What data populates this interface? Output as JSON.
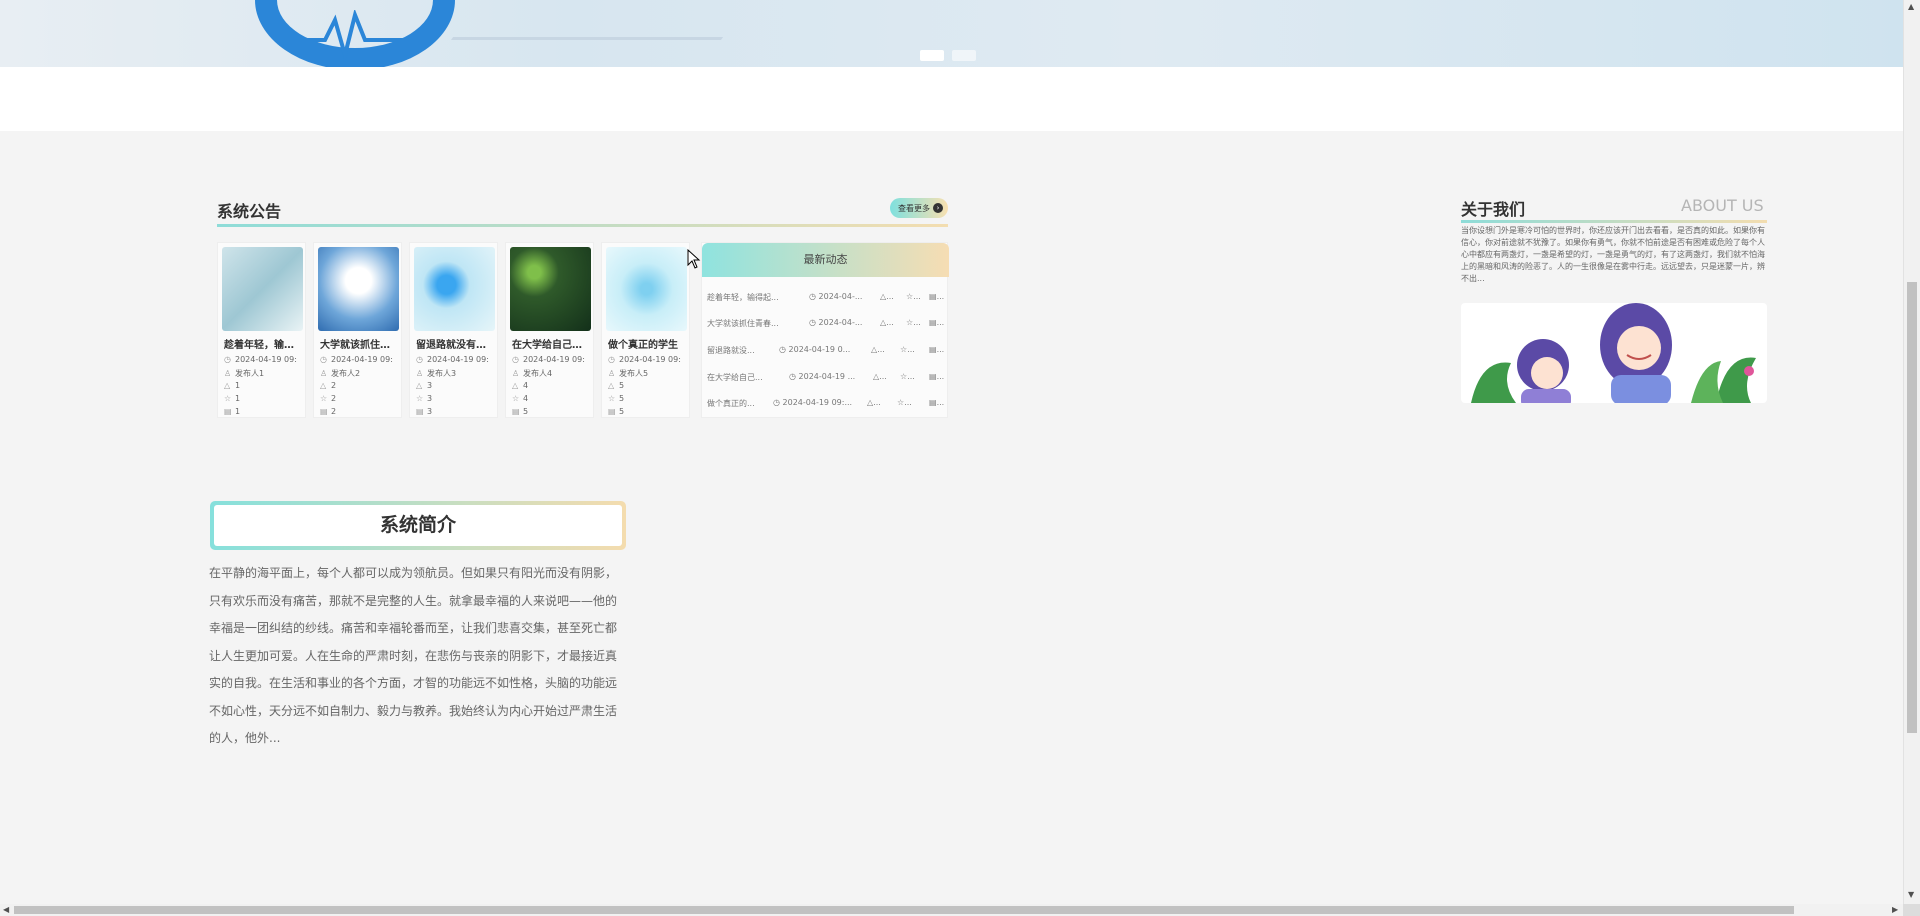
{
  "banner": {
    "dots": [
      "active",
      "inactive"
    ]
  },
  "notice": {
    "title": "系统公告",
    "more_label": "查看更多",
    "cards": [
      {
        "title": "趁着年轻，输…",
        "date": "2024-04-19 09:",
        "author": "发布人1",
        "likes": "1",
        "collects": "1",
        "comments": "1"
      },
      {
        "title": "大学就该抓住…",
        "date": "2024-04-19 09:",
        "author": "发布人2",
        "likes": "2",
        "collects": "2",
        "comments": "2"
      },
      {
        "title": "留退路就没有…",
        "date": "2024-04-19 09:",
        "author": "发布人3",
        "likes": "3",
        "collects": "3",
        "comments": "3"
      },
      {
        "title": "在大学给自己…",
        "date": "2024-04-19 09:",
        "author": "发布人4",
        "likes": "4",
        "collects": "4",
        "comments": "5"
      },
      {
        "title": "做个真正的学生",
        "date": "2024-04-19 09:",
        "author": "发布人5",
        "likes": "5",
        "collects": "5",
        "comments": "5"
      }
    ]
  },
  "news": {
    "header": "最新动态",
    "rows": [
      {
        "title": "趁着年轻，输得起...",
        "date": "2024-04-...",
        "like": "...",
        "fav": "...",
        "cmt": "..."
      },
      {
        "title": "大学就该抓住青春...",
        "date": "2024-04-...",
        "like": "...",
        "fav": "...",
        "cmt": "..."
      },
      {
        "title": "留退路就没...",
        "date": "2024-04-19 0...",
        "like": "...",
        "fav": "...",
        "cmt": "..."
      },
      {
        "title": "在大学给自己...",
        "date": "2024-04-19 ...",
        "like": "...",
        "fav": "...",
        "cmt": "..."
      },
      {
        "title": "做个真正的...",
        "date": "2024-04-19 09:...",
        "like": "...",
        "fav": "...",
        "cmt": "..."
      }
    ]
  },
  "intro": {
    "title": "系统简介",
    "text": "在平静的海平面上，每个人都可以成为领航员。但如果只有阳光而没有阴影，只有欢乐而没有痛苦，那就不是完整的人生。就拿最幸福的人来说吧——他的幸福是一团纠结的纱线。痛苦和幸福轮番而至，让我们悲喜交集，甚至死亡都让人生更加可爱。人在生命的严肃时刻，在悲伤与丧亲的阴影下，才最接近真实的自我。在生活和事业的各个方面，才智的功能远不如性格，头脑的功能远不如心性，天分远不如自制力、毅力与教养。我始终认为内心开始过严肃生活的人，他外..."
  },
  "about": {
    "title": "关于我们",
    "title_en": "ABOUT US",
    "text": "当你设想门外是寒冷可怕的世界时，你还应该开门出去看看，是否真的如此。如果你有信心，你对前途就不犹豫了。如果你有勇气，你就不怕前途是否有困难或危险了每个人心中都应有两盏灯，一盏是希望的灯，一盏是勇气的灯，有了这两盏灯，我们就不怕海上的黑暗和风涛的险恶了。人的一生很像是在雾中行走。远远望去，只是迷蒙一片，辨不出..."
  },
  "colors": {
    "accent_teal": "#8edcd8",
    "accent_peach": "#f3ddb0",
    "brand_blue": "#2b86d8"
  }
}
